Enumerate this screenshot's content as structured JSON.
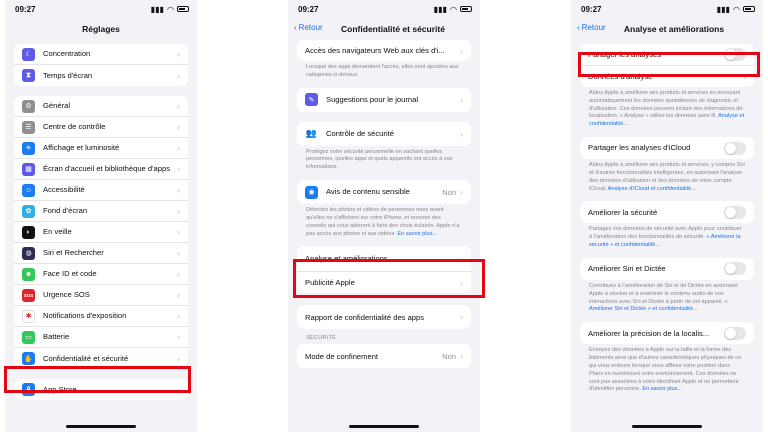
{
  "status": {
    "time": "09:27",
    "indicators": "⁂ ◉"
  },
  "panel1": {
    "title": "Réglages",
    "group1": [
      {
        "label": "Concentration",
        "icon": "moon-icon",
        "color": "#5e5ce6"
      },
      {
        "label": "Temps d'écran",
        "icon": "hourglass-icon",
        "color": "#5e5ce6"
      }
    ],
    "group2": [
      {
        "label": "Général",
        "icon": "gear-icon",
        "color": "#8e8e93"
      },
      {
        "label": "Centre de contrôle",
        "icon": "switches-icon",
        "color": "#8e8e93"
      },
      {
        "label": "Affichage et luminosité",
        "icon": "sun-icon",
        "color": "#1a7cf0"
      },
      {
        "label": "Écran d'accueil et bibliothèque d'apps",
        "icon": "grid-icon",
        "color": "#5e5ce6"
      },
      {
        "label": "Accessibilité",
        "icon": "accessibility-icon",
        "color": "#1a7cf0"
      },
      {
        "label": "Fond d'écran",
        "icon": "flower-icon",
        "color": "#30b0e8"
      },
      {
        "label": "En veille",
        "icon": "standby-icon",
        "color": "#111111"
      },
      {
        "label": "Siri et Rechercher",
        "icon": "siri-icon",
        "color": "#2c2c54"
      },
      {
        "label": "Face ID et code",
        "icon": "faceid-icon",
        "color": "#34c759"
      },
      {
        "label": "Urgence SOS",
        "icon": "sos-icon",
        "color": "#e0242c"
      },
      {
        "label": "Notifications d'exposition",
        "icon": "exposure-icon",
        "color": "#ffffff"
      },
      {
        "label": "Batterie",
        "icon": "battery-icon",
        "color": "#34c759"
      },
      {
        "label": "Confidentialité et sécurité",
        "icon": "hand-icon",
        "color": "#1a7cf0"
      }
    ],
    "group3": [
      {
        "label": "App Store",
        "icon": "appstore-icon",
        "color": "#1a7cf0"
      }
    ]
  },
  "panel2": {
    "back": "Retour",
    "title": "Confidentialité et sécurité",
    "web_access_label": "Accès des navigateurs Web aux clés d'i...",
    "web_access_note": "Lorsque des apps demandent l'accès, elles sont ajoutées aux catégories ci-dessus.",
    "journal_label": "Suggestions pour le journal",
    "safety_label": "Contrôle de sécurité",
    "safety_note": "Protégez votre sécurité personnelle en sachant quelles personnes, quelles apps et quels appareils ont accès à vos informations.",
    "sensitive_label": "Avis de contenu sensible",
    "sensitive_value": "Non",
    "sensitive_note": "Détectez les photos et vidéos de personnes nues avant qu'elles ne s'affichent sur votre iPhone, et recevez des conseils qui vous aideront à faire des choix éclairés. Apple n'a pas accès aux photos ni aux vidéos.",
    "sensitive_link": "En savoir plus...",
    "analytics_label": "Analyse et améliorations",
    "ads_label": "Publicité Apple",
    "report_label": "Rapport de confidentialité des apps",
    "security_header": "SÉCURITÉ",
    "lockdown_label": "Mode de confinement",
    "lockdown_value": "Non"
  },
  "panel3": {
    "back": "Retour",
    "title": "Analyse et améliorations",
    "share_label": "Partager les analyses",
    "data_label": "Données d'analyse",
    "share_note": "Aidez Apple à améliorer ses produits et services en envoyant automatiquement les données quotidiennes de diagnostic et d'utilisation. Ces données peuvent inclure des informations de localisation. « Analyse » utilise les données sans fil.",
    "share_link": "Analyse et confidentialité...",
    "icloud_label": "Partager les analyses d'iCloud",
    "icloud_note": "Aidez Apple à améliorer ses produits et services, y compris Siri et d'autres fonctionnalités intelligentes, en autorisant l'analyse des données d'utilisation et des données de votre compte iCloud.",
    "icloud_link": "Analyse d'iCloud et confidentialité...",
    "security_label": "Améliorer la sécurité",
    "security_note": "Partagez vos données de sécurité avec Apple pour contribuer à l'amélioration des fonctionnalités de sécurité.",
    "security_link": "« Améliorer la sécurité » et confidentialité...",
    "siri_label": "Améliorer Siri et Dictée",
    "siri_note": "Contribuez à l'amélioration de Siri et de Dictée en autorisant Apple à stocker et à examiner le contenu audio de vos interactions avec Siri et Dictée à partir de cet appareil.",
    "siri_link": "« Améliorer Siri et Dictée » et confidentialité...",
    "location_label": "Améliorer la précision de la localis...",
    "location_note": "Envoyez des données à Apple sur la taille et la forme des bâtiments ainsi que d'autres caractéristiques physiques de ce qui vous entoure lorsque vous affinez votre position dans Plans en numérisant votre environnement. Ces données ne sont pas associées à votre identifiant Apple et ne permettent d'identifier personne.",
    "location_link": "En savoir plus..."
  }
}
